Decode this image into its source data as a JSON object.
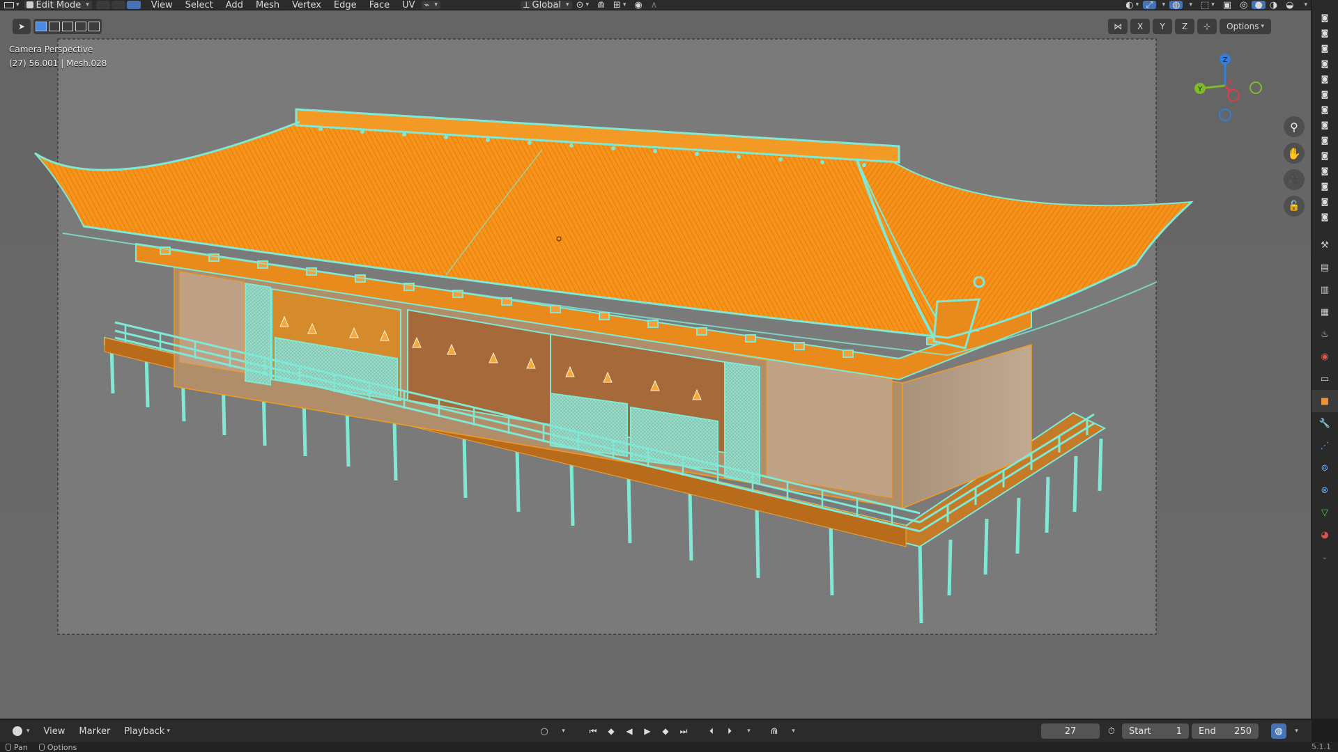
{
  "header": {
    "mode": "Edit Mode",
    "menus": [
      "View",
      "Select",
      "Add",
      "Mesh",
      "Vertex",
      "Edge",
      "Face",
      "UV"
    ],
    "transform_orientation": "Global"
  },
  "viewport": {
    "view_name": "Camera Perspective",
    "frame_object": "(27) 56.001 | Mesh.028",
    "axis_buttons": [
      "X",
      "Y",
      "Z"
    ],
    "options_label": "Options",
    "gizmo": {
      "x": "X",
      "y": "Y",
      "z": "Z"
    },
    "colors": {
      "selection_orange": "#ff9a1a",
      "wire_cyan": "#7fe9d6",
      "bg": "#6e6e6e"
    }
  },
  "timeline": {
    "menus": [
      "View",
      "Marker",
      "Playback"
    ],
    "current_frame": "27",
    "start_label": "Start",
    "start_value": "1",
    "end_label": "End",
    "end_value": "250"
  },
  "statusbar": {
    "left_items": [
      "Pan",
      "Options"
    ],
    "version": "5.1.1"
  }
}
